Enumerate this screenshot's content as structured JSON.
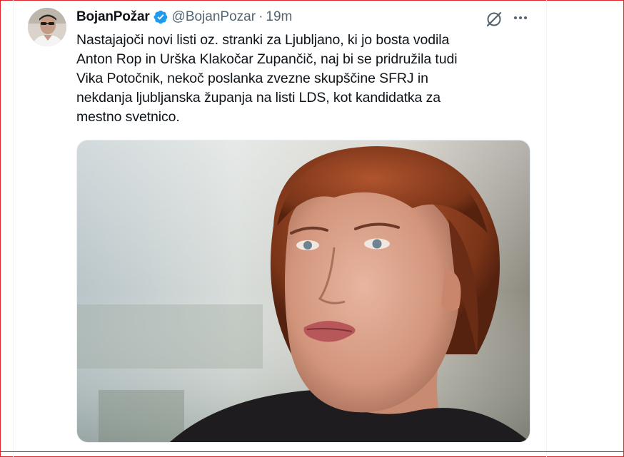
{
  "tweet": {
    "author_name": "BojanPožar",
    "handle": "@BojanPozar",
    "separator": "·",
    "time": "19m",
    "text": "Nastajajoči novi listi oz. stranki za Ljubljano, ki jo bosta vodila\nAnton Rop in Urška Klakočar Zupančič, naj bi se pridružila tudi\nVika Potočnik, nekoč poslanka zvezne skupščine SFRJ in\nnekdanja ljubljanska županja na listi LDS, kot kandidatka za\nmestno svetnico.",
    "verified_icon": "verified-badge-icon",
    "grok_icon": "grok-icon",
    "more_icon": "more-dots-icon",
    "accent_color": "#1d9bf0"
  }
}
